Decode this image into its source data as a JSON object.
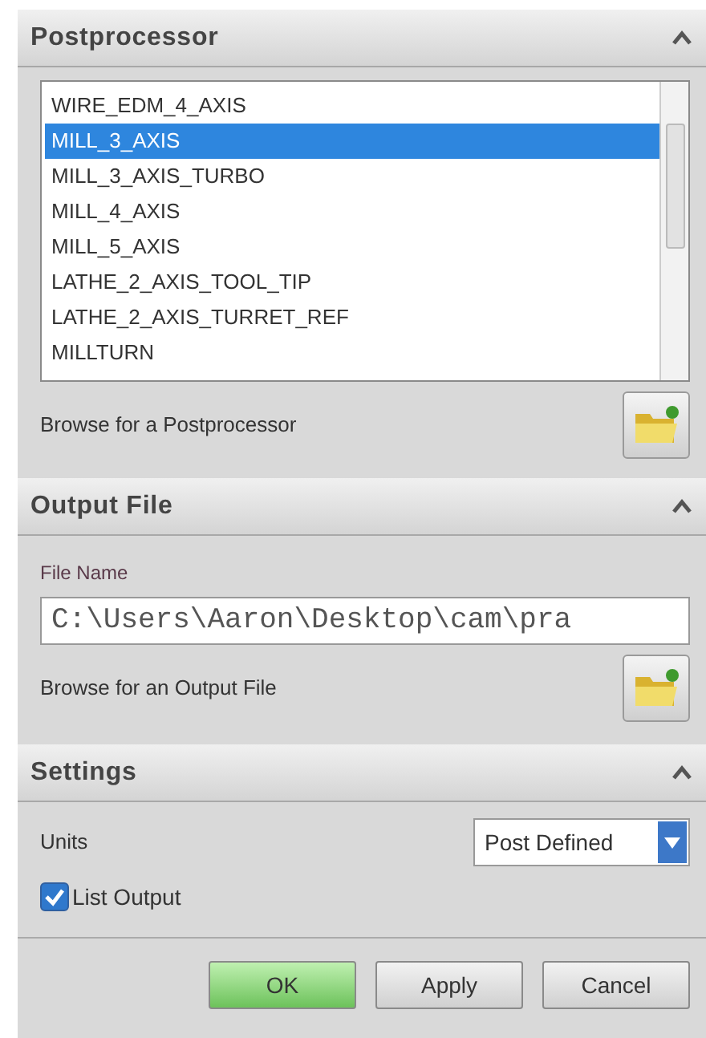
{
  "sections": [
    {
      "title": "Postprocessor",
      "expanded": true,
      "kind": "postprocessor",
      "list": [
        {
          "label": "WIRE_EDM_4_AXIS",
          "selected": false
        },
        {
          "label": "MILL_3_AXIS",
          "selected": true
        },
        {
          "label": "MILL_3_AXIS_TURBO",
          "selected": false
        },
        {
          "label": "MILL_4_AXIS",
          "selected": false
        },
        {
          "label": "MILL_5_AXIS",
          "selected": false
        },
        {
          "label": "LATHE_2_AXIS_TOOL_TIP",
          "selected": false
        },
        {
          "label": "LATHE_2_AXIS_TURRET_REF",
          "selected": false
        },
        {
          "label": "MILLTURN",
          "selected": false
        }
      ],
      "browse": "Browse for a Postprocessor"
    },
    {
      "title": "Output File",
      "expanded": true,
      "kind": "output",
      "field_label": "File Name",
      "value": "C:\\Users\\Aaron\\Desktop\\cam\\pra",
      "browse": "Browse for an Output File"
    },
    {
      "title": "Settings",
      "expanded": true,
      "kind": "settings",
      "units_label": "Units",
      "units_value": "Post Defined",
      "list_output": {
        "label": "List Output",
        "checked": true
      }
    }
  ],
  "buttons": [
    {
      "label": "OK",
      "default": true
    },
    {
      "label": "Apply",
      "default": false
    },
    {
      "label": "Cancel",
      "default": false
    }
  ]
}
